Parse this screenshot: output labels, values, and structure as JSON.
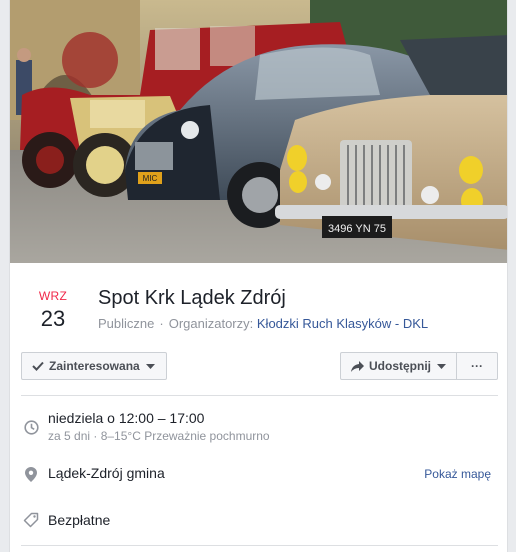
{
  "event": {
    "month": "WRZ",
    "day": "23",
    "title": "Spot Krk Lądek Zdrój",
    "privacy": "Publiczne",
    "separator": "·",
    "organizers_label": "Organizatorzy:",
    "organizer": "Kłodzki Ruch Klasyków - DKL"
  },
  "actions": {
    "interested_label": "Zainteresowana",
    "share_label": "Udostępnij",
    "more_label": "···"
  },
  "details": {
    "time_main": "niedziela o 12:00 – 17:00",
    "time_sub": "za 5 dni · 8–15°C Przeważnie pochmurno",
    "location": "Lądek-Zdrój gmina",
    "map_link": "Pokaż mapę",
    "price": "Bezpłatne"
  },
  "cover_plates": {
    "left": "MIC",
    "right": "3496 YN 75"
  },
  "colors": {
    "date_red": "#f02849",
    "link_blue": "#365899",
    "muted_text": "#90949c"
  },
  "icons": {
    "interested": "check-icon",
    "share": "share-arrow-icon",
    "time": "clock-icon",
    "location": "map-pin-icon",
    "price": "ticket-tag-icon"
  }
}
